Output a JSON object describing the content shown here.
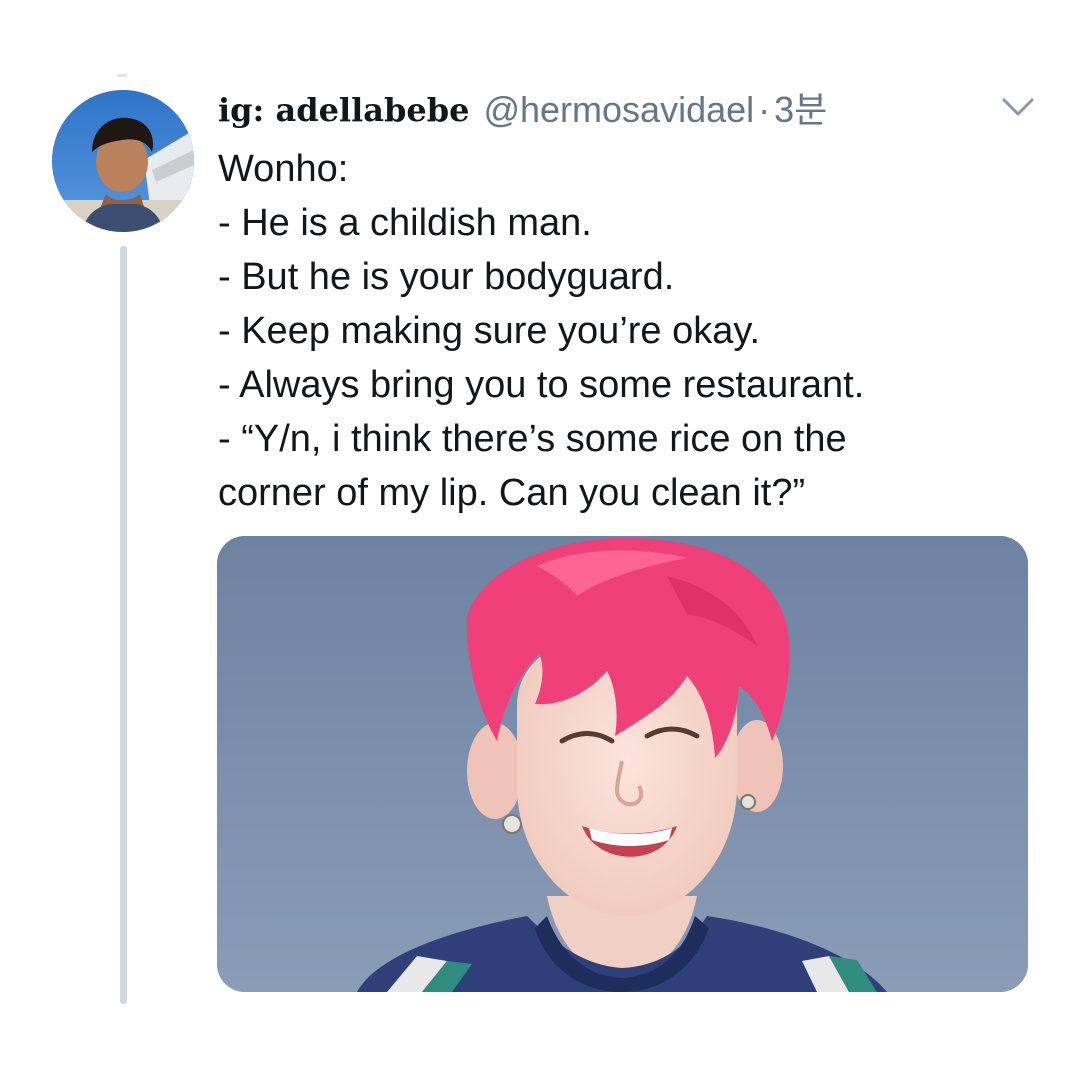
{
  "tweet": {
    "display_name": "ig: adellabebe",
    "handle": "@hermosavidael",
    "separator": "·",
    "time": "3분",
    "menu_icon": "chevron-down-icon",
    "avatar_icon": "avatar-photo",
    "lines": [
      "Wonho:",
      "- He is a childish man.",
      "- But he is your bodyguard.",
      "- Keep making sure you’re okay.",
      "- Always bring you to some restaurant.",
      "- “Y/n, i think there’s some rice on the",
      "corner of my lip. Can you clean it?”"
    ]
  },
  "colors": {
    "text": "#14171a",
    "secondary": "#657786",
    "thread_line": "#cfd9de",
    "hair": "#f0407a",
    "sky": "#7d90ac"
  }
}
